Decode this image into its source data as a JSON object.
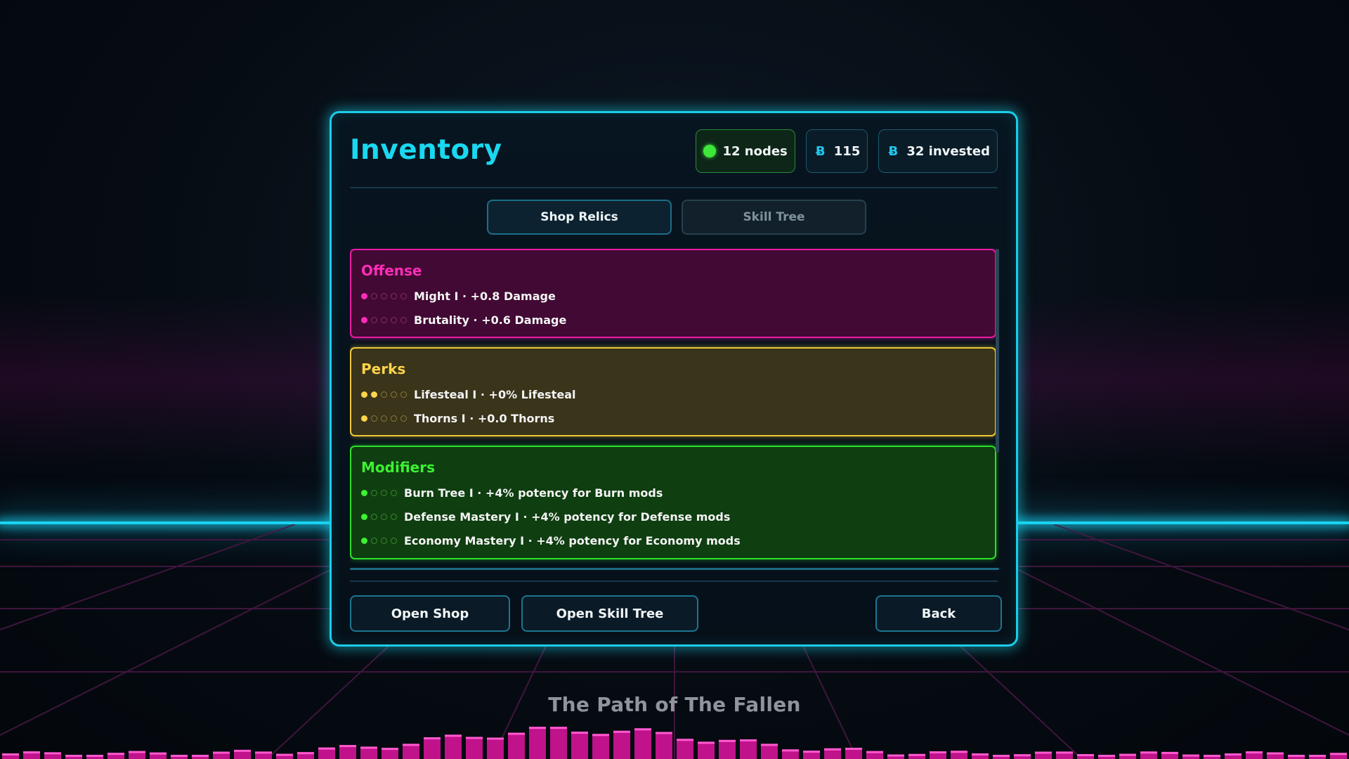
{
  "panel": {
    "title": "Inventory",
    "stats": {
      "nodes": "12 nodes",
      "coins": "115",
      "invested": "32 invested"
    },
    "tabs": [
      {
        "label": "Shop Relics",
        "active": true
      },
      {
        "label": "Skill Tree",
        "active": false
      }
    ],
    "categories": {
      "offense": {
        "title": "Offense",
        "color": "#ff2db8",
        "items": [
          {
            "label": "Might I · +0.8 Damage",
            "level": 1,
            "max": 5
          },
          {
            "label": "Brutality · +0.6 Damage",
            "level": 1,
            "max": 5
          }
        ]
      },
      "perks": {
        "title": "Perks",
        "color": "#ffd44a",
        "items": [
          {
            "label": "Lifesteal I · +0% Lifesteal",
            "level": 2,
            "max": 5
          },
          {
            "label": "Thorns I · +0.0 Thorns",
            "level": 1,
            "max": 5
          }
        ]
      },
      "modifiers": {
        "title": "Modifiers",
        "color": "#3cf232",
        "items": [
          {
            "label": "Burn Tree I · +4% potency for Burn mods",
            "level": 1,
            "max": 4
          },
          {
            "label": "Defense Mastery I · +4% potency for Defense mods",
            "level": 1,
            "max": 4
          },
          {
            "label": "Economy Mastery I · +4% potency for Economy mods",
            "level": 1,
            "max": 4
          }
        ]
      }
    },
    "buttons": {
      "open_shop": "Open Shop",
      "open_skill_tree": "Open Skill Tree",
      "back": "Back"
    }
  },
  "footer": {
    "now_playing": "The Path of The Fallen"
  },
  "colors": {
    "accent_cyan": "#1ccde8",
    "offense": "#ff2db8",
    "perks": "#ffd44a",
    "modifiers": "#3cf232",
    "nodes_dot": "#3ee83a"
  },
  "icons": {
    "nodes": "green-dot-icon",
    "coins": "bit-coin-icon",
    "invested": "bit-coin-icon"
  }
}
